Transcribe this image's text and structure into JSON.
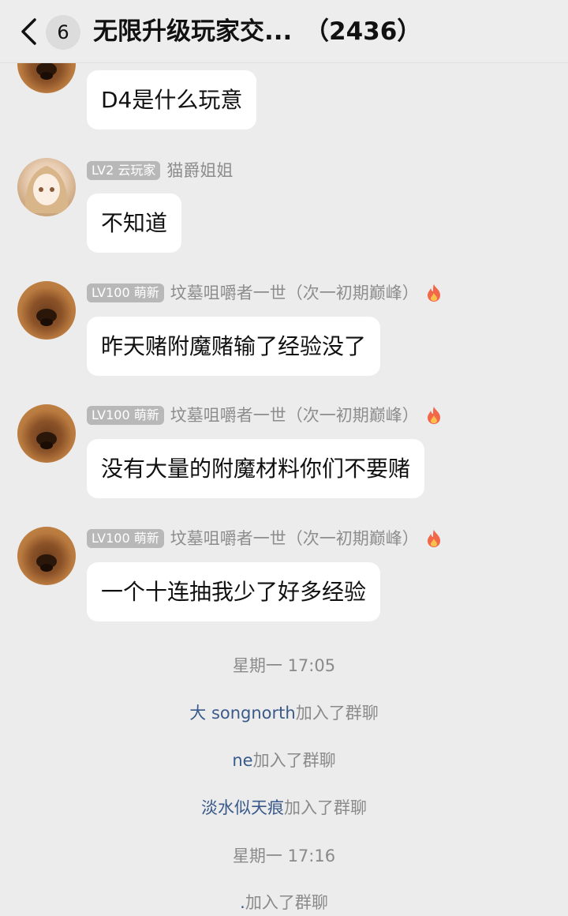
{
  "header": {
    "unread_count": "6",
    "title": "无限升级玩家交...",
    "member_count": "（2436）"
  },
  "messages": [
    {
      "text": "D4是什么玩意"
    },
    {
      "level": "LV2 云玩家",
      "sender": "猫爵姐姐",
      "text": "不知道"
    },
    {
      "level": "LV100 萌新",
      "sender": "坟墓咀嚼者一世（次一初期巅峰）",
      "text": "昨天赌附魔赌输了经验没了"
    },
    {
      "level": "LV100 萌新",
      "sender": "坟墓咀嚼者一世（次一初期巅峰）",
      "text": "没有大量的附魔材料你们不要赌"
    },
    {
      "level": "LV100 萌新",
      "sender": "坟墓咀嚼者一世（次一初期巅峰）",
      "text": "一个十连抽我少了好多经验"
    }
  ],
  "system": {
    "time1": "星期一 17:05",
    "join1_name": "大 songnorth",
    "join2_name": "ne",
    "join3_name": "淡水似天痕",
    "join_suffix": "加入了群聊",
    "time2": "星期一 17:16",
    "join4_name": ".",
    "join4_suffix": "加入了群聊"
  }
}
